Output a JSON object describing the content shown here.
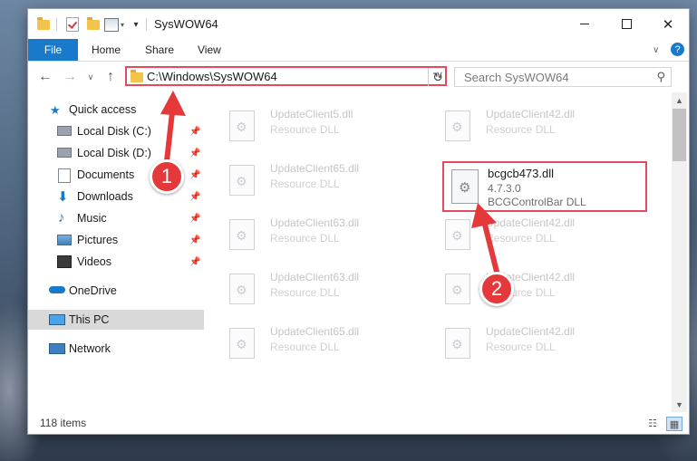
{
  "window": {
    "title": "SysWOW64",
    "minimize_icon": "minimize-icon",
    "maximize_icon": "maximize-icon",
    "close_icon": "close-icon"
  },
  "ribbon": {
    "tabs": [
      "File",
      "Home",
      "Share",
      "View"
    ],
    "help": "?"
  },
  "address": {
    "path": "C:\\Windows\\SysWOW64",
    "search_placeholder": "Search SysWOW64"
  },
  "nav_pane": {
    "items": [
      {
        "label": "Quick access",
        "icon": "star-icon"
      },
      {
        "label": "Local Disk (C:)",
        "icon": "drive-icon"
      },
      {
        "label": "Local Disk (D:)",
        "icon": "drive-icon"
      },
      {
        "label": "Documents",
        "icon": "documents-icon"
      },
      {
        "label": "Downloads",
        "icon": "download-icon"
      },
      {
        "label": "Music",
        "icon": "music-icon"
      },
      {
        "label": "Pictures",
        "icon": "pictures-icon"
      },
      {
        "label": "Videos",
        "icon": "videos-icon"
      },
      {
        "label": "OneDrive",
        "icon": "cloud-icon"
      },
      {
        "label": "This PC",
        "icon": "computer-icon"
      },
      {
        "label": "Network",
        "icon": "network-icon"
      }
    ],
    "selected": "This PC"
  },
  "files": [
    {
      "name": "UpdateClient5.dll",
      "type": "Resource DLL"
    },
    {
      "name": "UpdateClient42.dll",
      "type": "Resource DLL"
    },
    {
      "name": "UpdateClient65.dll",
      "type": "Resource DLL"
    },
    {
      "name": "UpdateClient63.dll",
      "type": "Resource DLL"
    },
    {
      "name": "UpdateClient42.dll",
      "type": "Resource DLL"
    },
    {
      "name": "UpdateClient63.dll",
      "type": "Resource DLL"
    },
    {
      "name": "UpdateClient42.dll",
      "type": "Resource DLL"
    },
    {
      "name": "UpdateClient65.dll",
      "type": "Resource DLL"
    },
    {
      "name": "UpdateClient42.dll",
      "type": "Resource DLL"
    }
  ],
  "highlighted_file": {
    "name": "bcgcb473.dll",
    "version": "4.7.3.0",
    "description": "BCGControlBar DLL"
  },
  "status": {
    "item_count": "118 items"
  },
  "annotations": {
    "step1": "1",
    "step2": "2",
    "color": "#e5383b"
  }
}
